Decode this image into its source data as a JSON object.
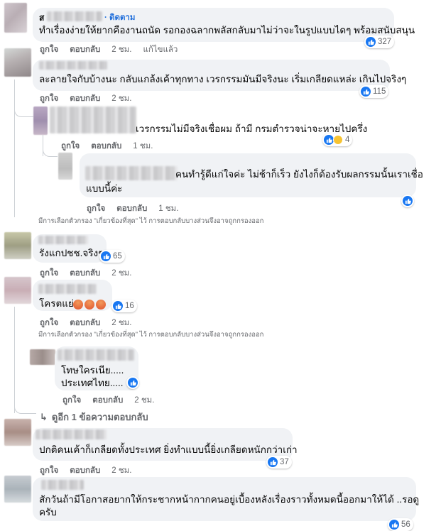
{
  "comments": [
    {
      "text": "ทำเรื่องง่ายให้ยากคืองานถนัด รอกองฉลากพลัสกลับมาไม่ว่าจะในรูปแบบไดๆ พร้อมสนับสนุน",
      "name_visible": "ส",
      "follow_label": "· ติดตาม",
      "like": "ถูกใจ",
      "reply": "ตอบกลับ",
      "time": "2 ชม.",
      "edited": "แก้ไขแล้ว",
      "reaction_count": "327"
    },
    {
      "text": "ละลายใจกับบ้างนะ กลับแกล้งเค้าทุกทาง เวรกรรมมันมีจริงนะ เริ่มเกลียดแหล่ะ เกินไปจริงๆ",
      "like": "ถูกใจ",
      "reply": "ตอบกลับ",
      "time": "2 ชม.",
      "reaction_count": "115"
    },
    {
      "text": "เวรกรรมไม่มีจริงเชื่อผม ถ้ามี กรมตำรวจน่าจะหายไปครึ่ง",
      "like": "ถูกใจ",
      "reply": "ตอบกลับ",
      "time": "1 ชม.",
      "reaction_count": "4"
    },
    {
      "text_line1": "คนทำรู้ดีแก่ใจค่ะ ไม่ช้าก็เร็ว ยังไงก็ต้องรับผลกรรมนั้นเราเชื่อ",
      "text_line2": "แบบนี้ค่ะ",
      "like": "ถูกใจ",
      "reply": "ตอบกลับ",
      "time": "1 ชม."
    },
    {
      "text": "รังแกปชช.จริงๆ",
      "like": "ถูกใจ",
      "reply": "ตอบกลับ",
      "time": "2 ชม.",
      "reaction_count": "65"
    },
    {
      "text": "โครตแย่",
      "like": "ถูกใจ",
      "reply": "ตอบกลับ",
      "time": "2 ชม.",
      "reaction_count": "16"
    },
    {
      "text_line1": "โทษใครเนีย.....",
      "text_line2": "ประเทศไทย.....",
      "like": "ถูกใจ",
      "reply": "ตอบกลับ",
      "time": "2 ชม."
    },
    {
      "text": "ปกติคนเค้าก็เกลียดทั้งประเทศ ยิ่งทำแบบนี้ยิ่งเกลียดหนักกว่าเก่า",
      "like": "ถูกใจ",
      "reply": "ตอบกลับ",
      "time": "2 ชม.",
      "reaction_count": "37"
    },
    {
      "text_line1": "สักวันถ้ามีโอกาสอยากให้กระชากหน้ากากคนอยู่เบื้องหลังเรื่องราวทั้งหมดนี้ออกมาให้ได้ ..รอดู",
      "text_line2": "ครับ",
      "reaction_count": "56"
    }
  ],
  "filter_notice": "มีการเลือกตัวกรอง \"เกี่ยวข้องที่สุด\" ไว้ การตอบกลับบางส่วนจึงอาจถูกกรองออก",
  "more_replies": "ดูอีก 1 ข้อความตอบกลับ",
  "colors": {
    "bubble": "#f0f2f5",
    "like_blue": "#1877f2",
    "secondary_text": "#65676b",
    "follow": "#216fdb"
  }
}
